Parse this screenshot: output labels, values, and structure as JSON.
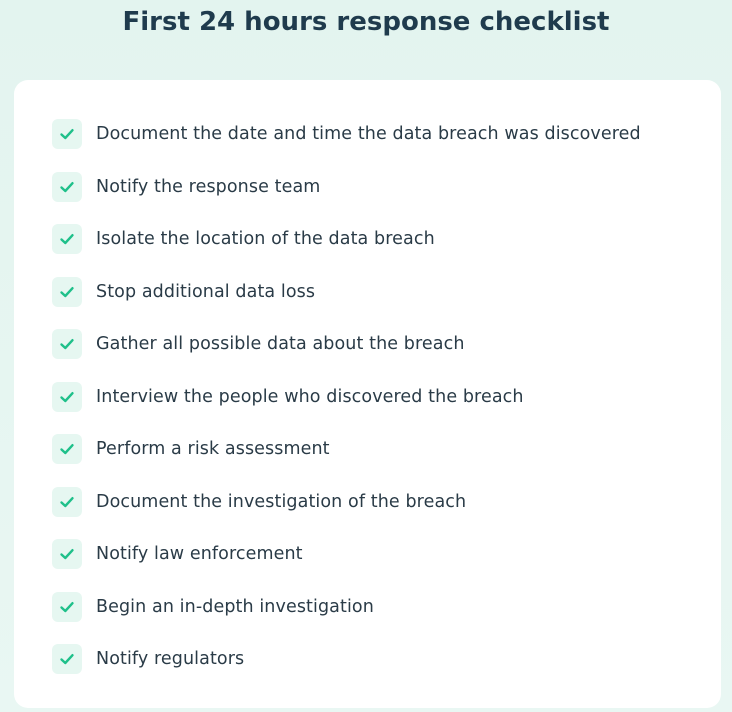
{
  "title": "First 24 hours response checklist",
  "check_color": "#1fc08a",
  "items": [
    {
      "label": "Document the date and time the data breach was discovered",
      "icon": "checkmark-icon"
    },
    {
      "label": "Notify the response team",
      "icon": "checkmark-icon"
    },
    {
      "label": "Isolate the location of the data breach",
      "icon": "checkmark-icon"
    },
    {
      "label": "Stop additional data loss",
      "icon": "checkmark-icon"
    },
    {
      "label": "Gather all possible data about the breach",
      "icon": "checkmark-icon"
    },
    {
      "label": "Interview the people who discovered the breach",
      "icon": "checkmark-icon"
    },
    {
      "label": "Perform a risk assessment",
      "icon": "checkmark-icon"
    },
    {
      "label": "Document the investigation of the breach",
      "icon": "checkmark-icon"
    },
    {
      "label": "Notify law enforcement",
      "icon": "checkmark-icon"
    },
    {
      "label": "Begin an in-depth investigation",
      "icon": "checkmark-icon"
    },
    {
      "label": "Notify regulators",
      "icon": "checkmark-icon"
    }
  ]
}
